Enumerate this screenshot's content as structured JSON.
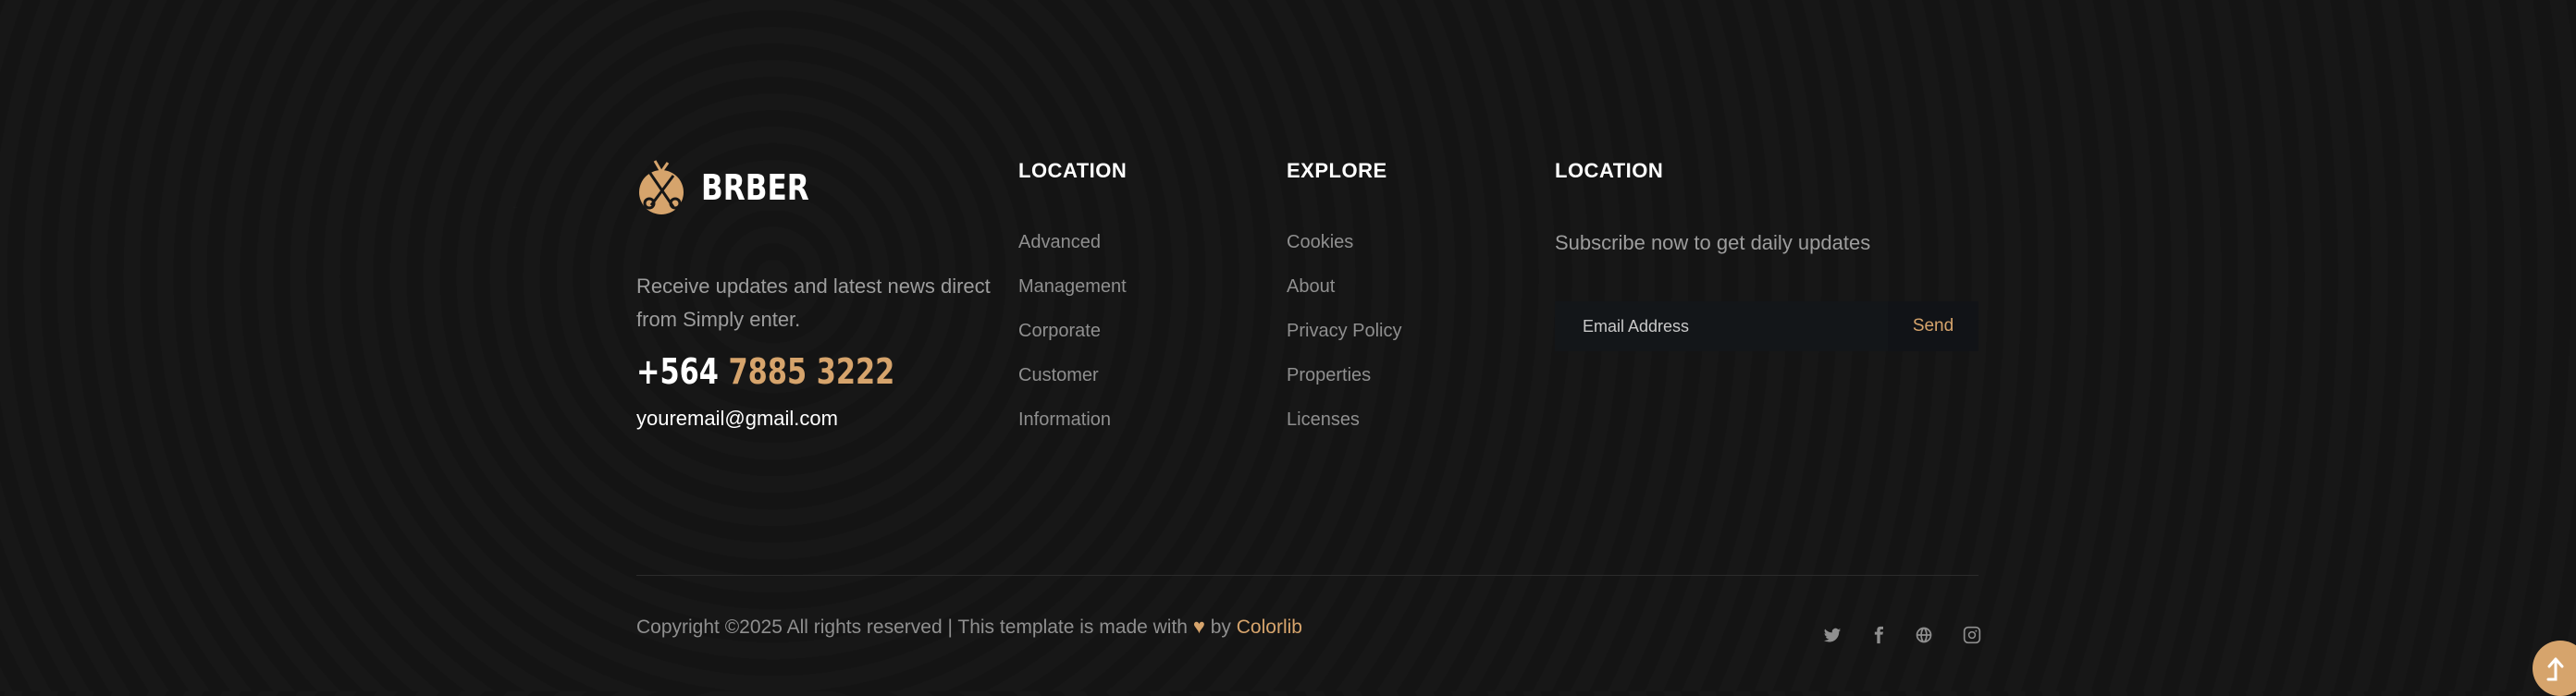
{
  "brand": {
    "name": "BRBER",
    "about": "Receive updates and latest news direct from Simply enter.",
    "phone_code": "+564",
    "phone_number": "7885 3222",
    "email": "youremail@gmail.com"
  },
  "columns": [
    {
      "heading": "LOCATION",
      "links": [
        "Advanced",
        "Management",
        "Corporate",
        "Customer",
        "Information"
      ]
    },
    {
      "heading": "EXPLORE",
      "links": [
        "Cookies",
        "About",
        "Privacy Policy",
        "Properties",
        "Licenses"
      ]
    }
  ],
  "subscribe": {
    "heading": "LOCATION",
    "text": "Subscribe now to get daily updates",
    "placeholder": "Email Address",
    "button": "Send"
  },
  "copyright": {
    "prefix": "Copyright ©2025 All rights reserved | This template is made with",
    "by": "by",
    "link": "Colorlib"
  },
  "social": [
    "twitter-icon",
    "facebook-icon",
    "globe-icon",
    "instagram-icon"
  ],
  "colors": {
    "accent": "#d6a46c",
    "background": "#161616",
    "text": "#9d9d9d",
    "heading": "#ffffff"
  }
}
